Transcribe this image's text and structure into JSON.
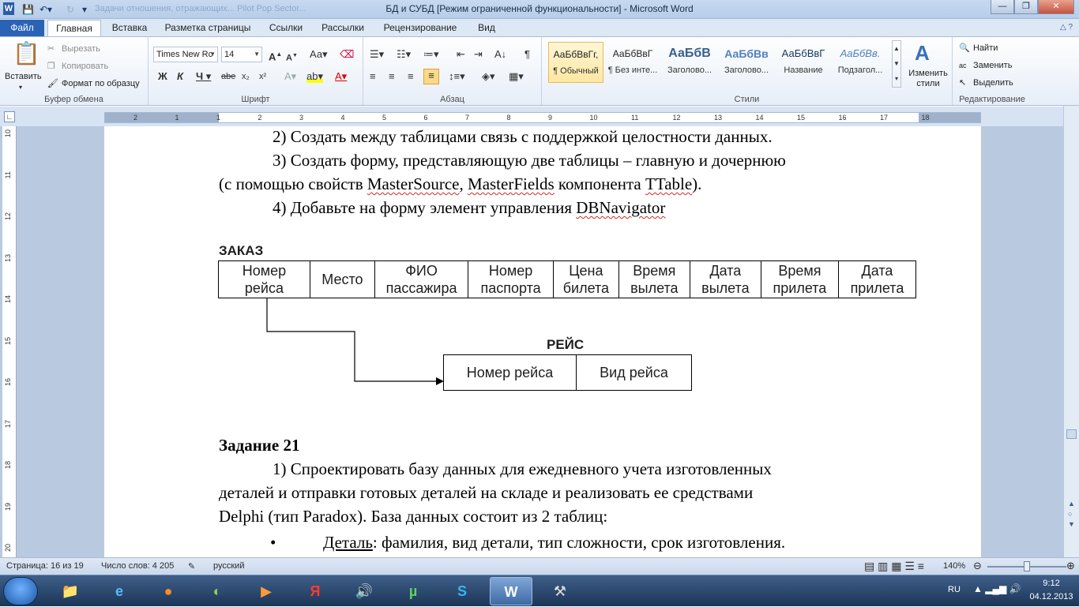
{
  "window": {
    "title": "БД и СУБД [Режим ограниченной функциональности]  -  Microsoft Word",
    "ghost_titles": "Задачи отношения, отражающих...    Pilot Pop Sector..."
  },
  "tabs": [
    "Файл",
    "Главная",
    "Вставка",
    "Разметка страницы",
    "Ссылки",
    "Рассылки",
    "Рецензирование",
    "Вид"
  ],
  "ribbon": {
    "clipboard": {
      "label": "Буфер обмена",
      "paste": "Вставить",
      "cut": "Вырезать",
      "copy": "Копировать",
      "format_painter": "Формат по образцу"
    },
    "font": {
      "label": "Шрифт",
      "font_name": "Times New Rc",
      "font_size": "14"
    },
    "paragraph": {
      "label": "Абзац"
    },
    "styles": {
      "label": "Стили",
      "items": [
        {
          "sample": "АаБбВвГг,",
          "name": "¶ Обычный"
        },
        {
          "sample": "АаБбВвГ",
          "name": "¶ Без инте..."
        },
        {
          "sample": "АаБбВ",
          "name": "Заголово..."
        },
        {
          "sample": "АаБбВв",
          "name": "Заголово..."
        },
        {
          "sample": "АаБбВвГ",
          "name": "Название"
        },
        {
          "sample": "АаБбВв.",
          "name": "Подзагол..."
        }
      ],
      "change_styles": "Изменить стили"
    },
    "editing": {
      "label": "Редактирование",
      "find": "Найти",
      "replace": "Заменить",
      "select": "Выделить"
    }
  },
  "ruler": {
    "numbers": [
      "2",
      "1",
      "1",
      "2",
      "3",
      "4",
      "5",
      "6",
      "7",
      "8",
      "9",
      "10",
      "11",
      "12",
      "13",
      "14",
      "15",
      "16",
      "17",
      "18"
    ],
    "vertical_numbers": [
      "10",
      "11",
      "12",
      "13",
      "14",
      "15",
      "16",
      "17",
      "18",
      "19",
      "20"
    ]
  },
  "document": {
    "line1": "2) Создать между таблицами связь с поддержкой целостности данных.",
    "line2": "3) Создать форму, представляющую две таблицы – главную и дочернюю",
    "line3_a": "(с помощью свойств ",
    "line3_b": "MasterSource",
    "line3_c": ", ",
    "line3_d": "MasterFields",
    "line3_e": " компонента ",
    "line3_f": "TTable",
    "line3_g": ").",
    "line4_a": "4) Добавьте на форму элемент управления ",
    "line4_b": "DBNavigator",
    "table1_title": "ЗАКАЗ",
    "table1_cols": [
      [
        "Номер",
        "рейса"
      ],
      [
        "Место",
        ""
      ],
      [
        "ФИО",
        "пассажира"
      ],
      [
        "Номер",
        "паспорта"
      ],
      [
        "Цена",
        "билета"
      ],
      [
        "Время",
        "вылета"
      ],
      [
        "Дата",
        "вылета"
      ],
      [
        "Время",
        "прилета"
      ],
      [
        "Дата",
        "прилета"
      ]
    ],
    "table2_title": "РЕЙС",
    "table2_cols": [
      "Номер рейса",
      "Вид рейса"
    ],
    "task_heading": "Задание 21",
    "task_line1": "1)  Спроектировать  базу  данных  для  ежедневного  учета  изготовленных",
    "task_line2": "деталей  и  отправки  готовых  деталей  на  складе  и  реализовать  ее  средствами",
    "task_line3": "Delphi (тип Paradox). База данных состоит из 2 таблиц:",
    "bullet_term": "Деталь",
    "bullet_rest": ": фамилия, вид детали, тип сложности, срок изготовления."
  },
  "status": {
    "page": "Страница: 16 из 19",
    "words": "Число слов: 4 205",
    "lang": "русский",
    "zoom": "140%"
  },
  "taskbar": {
    "lang": "RU",
    "time": "9:12",
    "date": "04.12.2013"
  }
}
